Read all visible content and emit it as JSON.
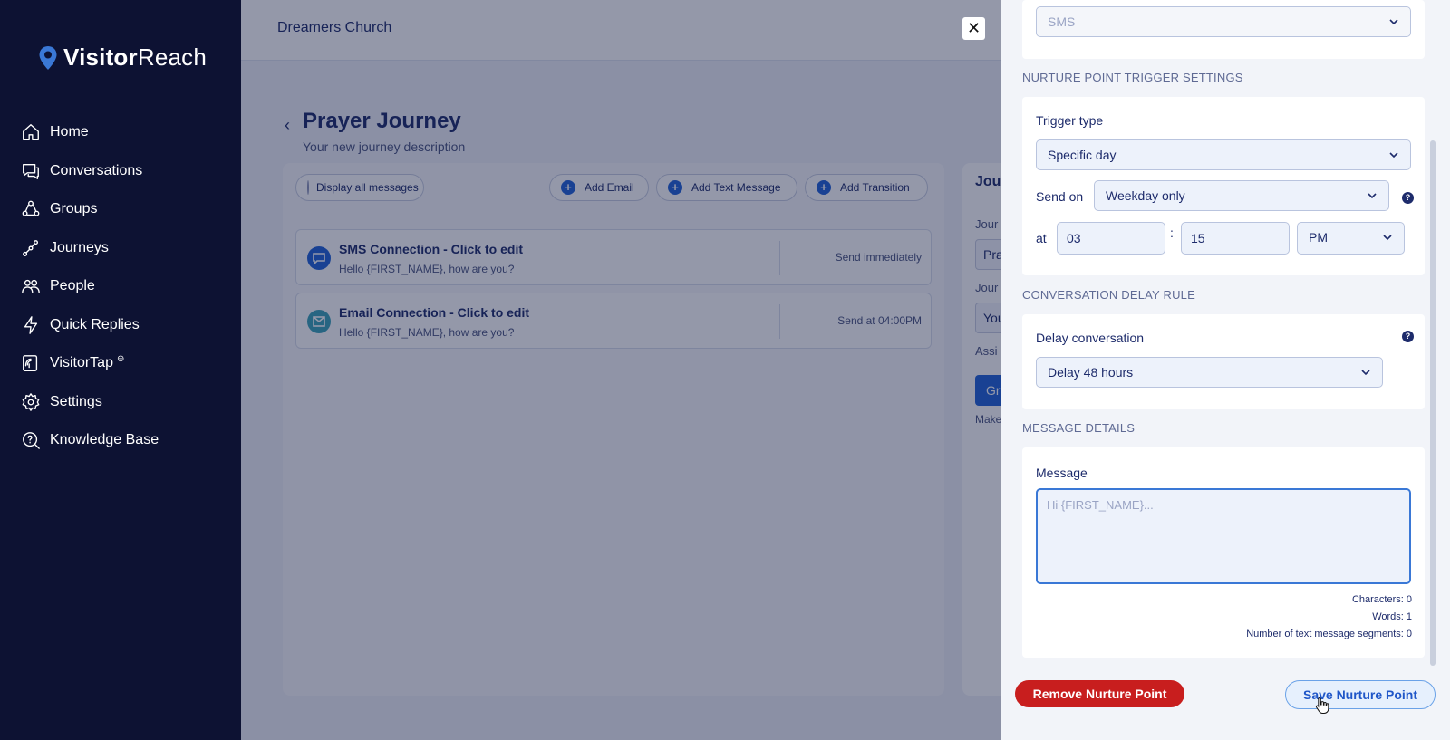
{
  "brand": {
    "name_bold": "Visitor",
    "name_light": "Reach",
    "accent": "#3a78d6"
  },
  "sidebar": {
    "items": [
      {
        "label": "Home",
        "icon": "home-icon"
      },
      {
        "label": "Conversations",
        "icon": "chat-icon"
      },
      {
        "label": "Groups",
        "icon": "groups-icon"
      },
      {
        "label": "Journeys",
        "icon": "journey-icon"
      },
      {
        "label": "People",
        "icon": "people-icon"
      },
      {
        "label": "Quick Replies",
        "icon": "bolt-icon"
      },
      {
        "label": "VisitorTap",
        "icon": "tap-icon",
        "badge": "⊖"
      },
      {
        "label": "Settings",
        "icon": "gear-icon"
      },
      {
        "label": "Knowledge Base",
        "icon": "help-search-icon"
      }
    ]
  },
  "header": {
    "church_name": "Dreamers Church"
  },
  "page": {
    "title": "Prayer Journey",
    "description": "Your new journey description",
    "toolbar": {
      "display_all": "Display all messages",
      "add_email": "Add Email",
      "add_text": "Add Text Message",
      "add_transition": "Add Transition"
    },
    "messages": [
      {
        "title": "SMS Connection - Click to edit",
        "body": "Hello {FIRST_NAME}, how are you?",
        "when": "Send immediately"
      },
      {
        "title": "Email Connection - Click to edit",
        "body": "Hello {FIRST_NAME}, how are you?",
        "when": "Send at 04:00PM"
      }
    ],
    "side_panel": {
      "title": "Jou",
      "label1": "Jour",
      "value1": "Pra",
      "label2": "Jour",
      "value2": "You",
      "label3": "Assi",
      "button": "Gr",
      "note": "Make"
    }
  },
  "drawer": {
    "channel_value": "SMS",
    "trigger_section": "Nurture Point Trigger Settings",
    "trigger_type_label": "Trigger type",
    "trigger_type_value": "Specific day",
    "send_on_label": "Send on",
    "send_on_value": "Weekday only",
    "at_label": "at",
    "hour": "03",
    "minute": "15",
    "ampm": "PM",
    "time_sep": ":",
    "delay_section": "Conversation Delay Rule",
    "delay_label": "Delay conversation",
    "delay_value": "Delay 48 hours",
    "message_section": "Message Details",
    "message_label": "Message",
    "message_placeholder": "Hi {FIRST_NAME}...",
    "characters": "Characters: 0",
    "words": "Words: 1",
    "segments": "Number of text message segments: 0",
    "remove_button": "Remove Nurture Point",
    "save_button": "Save Nurture Point",
    "help_glyph": "?",
    "close_glyph": "✕"
  },
  "colors": {
    "sidebar": "#0d1233",
    "danger": "#c81e1e",
    "primary": "#1f62d8"
  }
}
